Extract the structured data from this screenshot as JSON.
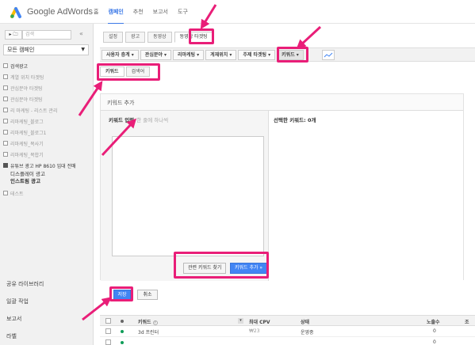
{
  "topbar": {
    "brand": "Google AdWords",
    "nav": [
      "홈",
      "캠페인",
      "추천",
      "보고서",
      "도구"
    ]
  },
  "sidebar": {
    "folder_label": "▸ 🗀",
    "search_placeholder": "검색",
    "collapse_label": "«",
    "all_campaigns_label": "모든 캠페인",
    "campaigns": [
      {
        "label": "검색광고",
        "dark": true
      },
      {
        "label": "계열 위치 타겟팅",
        "dark": false
      },
      {
        "label": "관심분야 타겟팅",
        "dark": false
      },
      {
        "label": "관심분야 타겟팅",
        "dark": false
      },
      {
        "label": "리 마케팅 - 리스트 관리",
        "dark": false
      },
      {
        "label": "리마케팅_블로그",
        "dark": false
      },
      {
        "label": "리마케팅_블로그1",
        "dark": false
      },
      {
        "label": "리마케팅_복사기",
        "dark": false
      },
      {
        "label": "리마케팅_복합기",
        "dark": false
      },
      {
        "label": "유튜브 광고 HP 8610 임대 전매",
        "dark": true
      }
    ],
    "sub_lines": [
      "디스플레이 광고",
      "인스트림 광고"
    ],
    "last_campaign": "테스트",
    "bottom": [
      "공유 라이브러리",
      "일괄 작업",
      "보고서",
      "라벨"
    ]
  },
  "main": {
    "tabs1": [
      "설정",
      "광고",
      "동영상",
      "동영상 타겟팅"
    ],
    "tabs2": [
      "사용자 층계 ▾",
      "관심분야 ▾",
      "리마케팅 ▾",
      "게재위치 ▾",
      "주제 타겟팅 ▾",
      "키워드 ▾"
    ],
    "tabs3": [
      "키워드",
      "검색어"
    ],
    "panel_title": "키워드 추가",
    "kw_input_label": "키워드 입력",
    "kw_input_hint": "한 줄에 하나씩",
    "selected_label": "선택한 키워드: 0개",
    "btn_related": "관련 키워드 찾기",
    "btn_add_kw": "키워드 추가 »",
    "btn_save": "저장",
    "btn_cancel": "취소"
  },
  "table": {
    "headers": [
      "키워드",
      "최대 CPV",
      "상태",
      "노출수",
      "조"
    ],
    "rows": [
      {
        "keyword": "3d 프린터",
        "max_cpv": "₩23",
        "status": "운영중",
        "impressions": "0"
      },
      {
        "keyword": "",
        "max_cpv": "",
        "status": "",
        "impressions": "0"
      }
    ]
  },
  "colors": {
    "annotation": "#e91e78",
    "accent": "#4285f4"
  }
}
